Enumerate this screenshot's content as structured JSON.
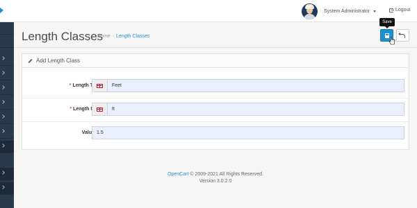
{
  "header": {
    "user_name": "System Administrator",
    "logout_label": "Logout"
  },
  "page": {
    "title": "Length Classes",
    "breadcrumbs": [
      "Home",
      "Length Classes"
    ],
    "save_tooltip": "Save"
  },
  "panel": {
    "heading": "Add Length Class",
    "fields": {
      "length_title": {
        "label": "Length Title",
        "required": true,
        "value": "Feet",
        "flag": "uk-flag-icon"
      },
      "length_unit": {
        "label": "Length Unit",
        "required": true,
        "value": "ft",
        "flag": "uk-flag-icon"
      },
      "value": {
        "label": "Value",
        "value": "1.5"
      }
    }
  },
  "footer": {
    "brand": "OpenCart",
    "copyright": "© 2009-2021 All Rights Reserved.",
    "version": "Version 3.0.2.0"
  },
  "colors": {
    "accent": "#1e91cf",
    "sidebar": "#2b3a4a",
    "required": "#e3503e"
  }
}
